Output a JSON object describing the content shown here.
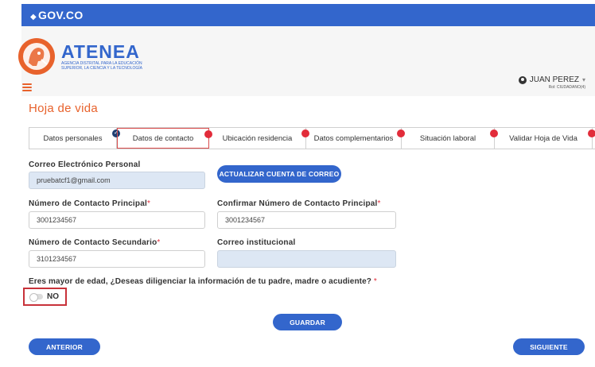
{
  "govbar": {
    "logo": "GOV.CO"
  },
  "brand": {
    "title": "ATENEA",
    "subtitle": "AGENCIA DISTRITAL PARA LA EDUCACIÓN SUPERIOR, LA CIENCIA Y LA TECNOLOGÍA"
  },
  "user": {
    "name": "JUAN PEREZ",
    "role": "Rol: CIUDADANO(4)"
  },
  "page_title": "Hoja de vida",
  "tabs": [
    {
      "label": "Datos personales",
      "status": "complete"
    },
    {
      "label": "Datos de contacto",
      "status": "pending"
    },
    {
      "label": "Ubicación residencia",
      "status": "pending"
    },
    {
      "label": "Datos complementarios",
      "status": "pending"
    },
    {
      "label": "Situación laboral",
      "status": "pending"
    },
    {
      "label": "Validar Hoja de Vida",
      "status": "pending"
    }
  ],
  "form": {
    "personal_email": {
      "label": "Correo Electrónico Personal",
      "value": "pruebatcf1@gmail.com"
    },
    "update_email_button": "ACTUALIZAR CUENTA DE CORREO",
    "main_contact": {
      "label": "Número de Contacto Principal",
      "required": "*",
      "value": "3001234567"
    },
    "confirm_main_contact": {
      "label": "Confirmar Número de Contacto Principal",
      "required": "*",
      "value": "3001234567"
    },
    "secondary_contact": {
      "label": "Número de Contacto Secundario",
      "required": "*",
      "value": "3101234567"
    },
    "institutional_email": {
      "label": "Correo institucional",
      "value": ""
    },
    "question": "Eres mayor de edad, ¿Deseas diligenciar la información de tu padre, madre o acudiente?",
    "question_required": "*",
    "toggle_label": "NO",
    "toggle_on": false,
    "save_button": "GUARDAR",
    "prev_button": "ANTERIOR",
    "next_button": "SIGUIENTE"
  },
  "colors": {
    "gov_blue": "#3366cc",
    "accent_orange": "#e8622c",
    "pending_red": "#e22c3a",
    "complete_navy": "#1f3f73"
  }
}
